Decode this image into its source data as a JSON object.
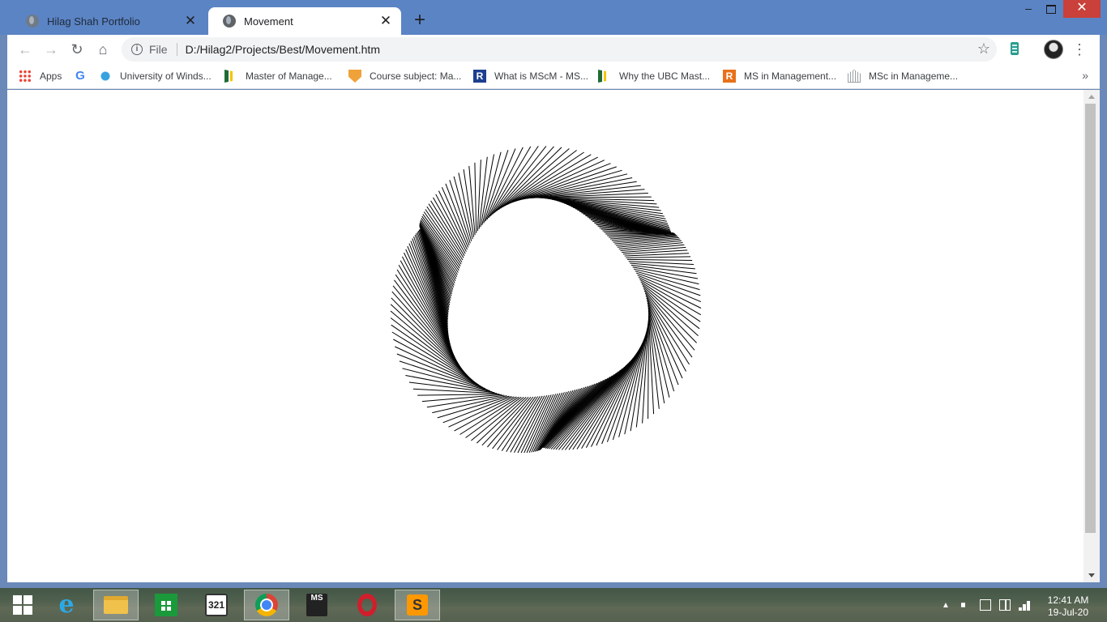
{
  "window": {
    "minimize": "–",
    "close": "✕"
  },
  "tabs": [
    {
      "title": "Hilag Shah Portfolio",
      "icon": "globe-icon",
      "active": false
    },
    {
      "title": "Movement",
      "icon": "globe-icon",
      "active": true
    }
  ],
  "toolbar": {
    "back": "←",
    "forward": "→",
    "reload": "↻",
    "home": "⌂",
    "scheme": "File",
    "url": "D:/Hilag2/Projects/Best/Movement.htm",
    "star": "☆",
    "menu": "⋮"
  },
  "bookmarks": [
    {
      "label": "Apps",
      "icon": "apps-grid-icon"
    },
    {
      "label": "",
      "icon": "google-icon"
    },
    {
      "label": "University of Winds...",
      "icon": "university-icon"
    },
    {
      "label": "Master of Manage...",
      "icon": "flag-icon"
    },
    {
      "label": "Course subject: Ma...",
      "icon": "crest-icon"
    },
    {
      "label": "What is MScM - MS...",
      "icon": "r-icon"
    },
    {
      "label": "Why the UBC Mast...",
      "icon": "flag-icon"
    },
    {
      "label": "MS in Management...",
      "icon": "r-icon"
    },
    {
      "label": "MSc in Manageme...",
      "icon": "building-icon"
    }
  ],
  "bookmark_overflow": "»",
  "artwork": {
    "stroke": "#000000",
    "background": "#ffffff"
  },
  "taskbar": {
    "ie": "e",
    "mpc": "321",
    "ms": "MS",
    "clock_time": "12:41 AM",
    "clock_date": "19-Jul-20"
  }
}
